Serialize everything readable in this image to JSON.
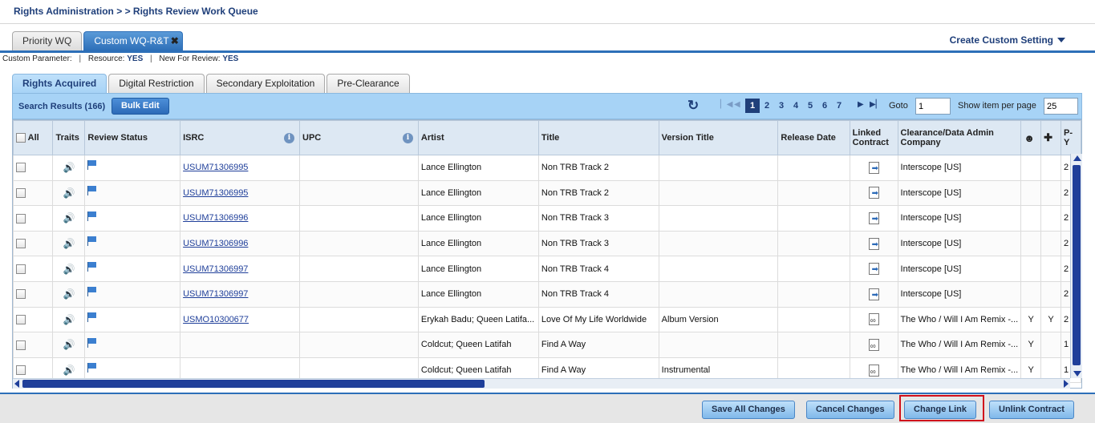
{
  "breadcrumb": "Rights Administration > > Rights Review Work Queue",
  "wq_tabs": [
    {
      "label": "Priority WQ",
      "active": false
    },
    {
      "label": "Custom WQ-R&T",
      "active": true,
      "close": "✖"
    }
  ],
  "create_custom_setting": "Create Custom Setting",
  "custom_param": {
    "label": "Custom Parameter:",
    "resource_label": "Resource:",
    "resource_value": "YES",
    "new_review_label": "New For Review:",
    "new_review_value": "YES",
    "sep": "|"
  },
  "sub_tabs": [
    {
      "label": "Rights Acquired",
      "active": true
    },
    {
      "label": "Digital Restriction",
      "active": false
    },
    {
      "label": "Secondary Exploitation",
      "active": false
    },
    {
      "label": "Pre-Clearance",
      "active": false
    }
  ],
  "results": {
    "label": "Search Results (166)",
    "bulk_edit": "Bulk Edit",
    "pages": [
      "1",
      "2",
      "3",
      "4",
      "5",
      "6",
      "7"
    ],
    "current_page": "1",
    "goto_label": "Goto",
    "goto_value": "1",
    "show_label": "Show item per page",
    "show_value": "25"
  },
  "columns": {
    "all": "All",
    "traits": "Traits",
    "review_status": "Review Status",
    "isrc": "ISRC",
    "upc": "UPC",
    "artist": "Artist",
    "title": "Title",
    "version_title": "Version Title",
    "release_date": "Release Date",
    "linked_contract": "Linked Contract",
    "clearance": "Clearance/Data Admin Company",
    "py": "P-Y"
  },
  "rows": [
    {
      "isrc": "USUM71306995",
      "upc": "",
      "artist": "Lance Ellington",
      "title": "Non TRB Track 2",
      "version": "",
      "release": "",
      "link": "linked",
      "company": "Interscope [US]",
      "c1": "",
      "c2": "",
      "py": "2"
    },
    {
      "isrc": "USUM71306995",
      "upc": "",
      "artist": "Lance Ellington",
      "title": "Non TRB Track 2",
      "version": "",
      "release": "",
      "link": "linked",
      "company": "Interscope [US]",
      "c1": "",
      "c2": "",
      "py": "2"
    },
    {
      "isrc": "USUM71306996",
      "upc": "",
      "artist": "Lance Ellington",
      "title": "Non TRB Track 3",
      "version": "",
      "release": "",
      "link": "linked",
      "company": "Interscope [US]",
      "c1": "",
      "c2": "",
      "py": "2"
    },
    {
      "isrc": "USUM71306996",
      "upc": "",
      "artist": "Lance Ellington",
      "title": "Non TRB Track 3",
      "version": "",
      "release": "",
      "link": "linked",
      "company": "Interscope [US]",
      "c1": "",
      "c2": "",
      "py": "2"
    },
    {
      "isrc": "USUM71306997",
      "upc": "",
      "artist": "Lance Ellington",
      "title": "Non TRB Track 4",
      "version": "",
      "release": "",
      "link": "linked",
      "company": "Interscope [US]",
      "c1": "",
      "c2": "",
      "py": "2"
    },
    {
      "isrc": "USUM71306997",
      "upc": "",
      "artist": "Lance Ellington",
      "title": "Non TRB Track 4",
      "version": "",
      "release": "",
      "link": "linked",
      "company": "Interscope [US]",
      "c1": "",
      "c2": "",
      "py": "2"
    },
    {
      "isrc": "USMO10300677",
      "upc": "",
      "artist": "Erykah Badu; Queen Latifa...",
      "title": "Love Of My Life Worldwide",
      "version": "Album Version",
      "release": "",
      "link": "chain",
      "company": "The Who / Will I Am Remix -...",
      "c1": "Y",
      "c2": "Y",
      "py": "2"
    },
    {
      "isrc": "",
      "upc": "",
      "artist": "Coldcut; Queen Latifah",
      "title": "Find A Way",
      "version": "",
      "release": "",
      "link": "chain",
      "company": "The Who / Will I Am Remix -...",
      "c1": "Y",
      "c2": "",
      "py": "1"
    },
    {
      "isrc": "",
      "upc": "",
      "artist": "Coldcut; Queen Latifah",
      "title": "Find A Way",
      "version": "Instrumental",
      "release": "",
      "link": "chain",
      "company": "The Who / Will I Am Remix -...",
      "c1": "Y",
      "c2": "",
      "py": "1"
    }
  ],
  "footer": {
    "save_all": "Save All Changes",
    "cancel": "Cancel Changes",
    "change_link": "Change Link",
    "unlink": "Unlink Contract"
  },
  "colors": {
    "brand_blue": "#2d6fb8",
    "header_text": "#1f3f7a",
    "highlight_red": "#d0101c",
    "toolbar_bg": "#a7d3f6"
  },
  "icons": {
    "traits": "speaker-icon",
    "review_status": "flag-icon",
    "linked_contract": "document-link-icon",
    "refresh": "refresh-icon"
  }
}
